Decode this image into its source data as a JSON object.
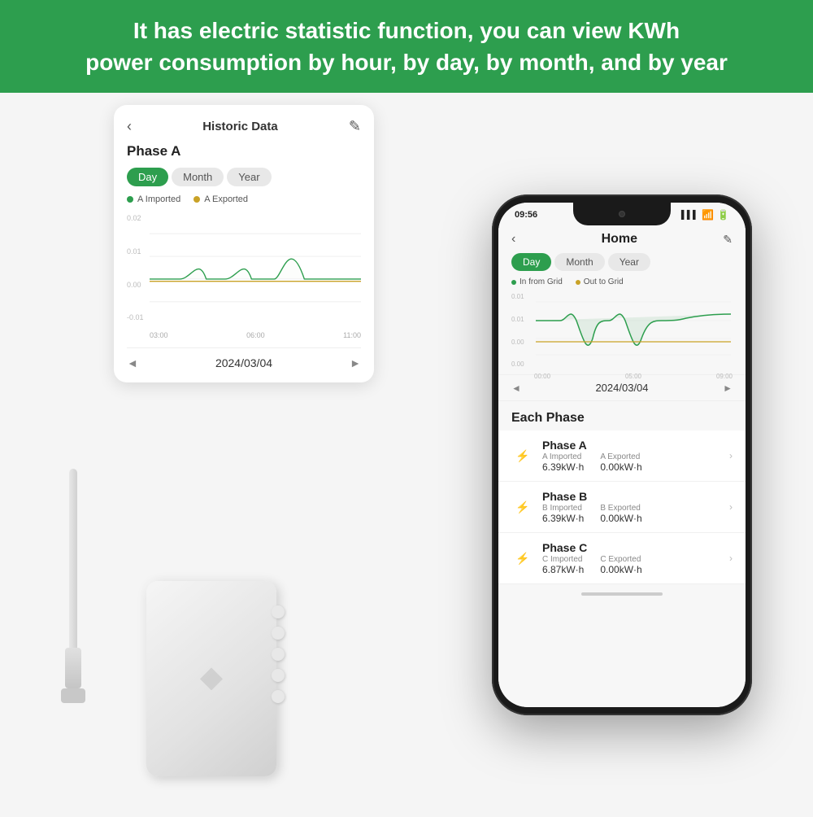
{
  "header": {
    "line1": "It has electric statistic function, you can view KWh",
    "line2": "power consumption by hour, by day, by month, and by year",
    "bg_color": "#2d9e4e",
    "text_color": "#ffffff"
  },
  "historic_card": {
    "title": "Historic Data",
    "back_icon": "‹",
    "edit_icon": "✎",
    "phase_label": "Phase A",
    "tabs": [
      "Day",
      "Month",
      "Year"
    ],
    "active_tab": "Day",
    "legend": [
      {
        "label": "A Imported",
        "color": "#2d9e4e"
      },
      {
        "label": "A Exported",
        "color": "#c9a227"
      }
    ],
    "y_labels": [
      "0.02",
      "0.01",
      "0.00",
      "-0.01"
    ],
    "x_labels": [
      "03:00",
      "06:00",
      "11:00"
    ],
    "date": "2024/03/04"
  },
  "phone": {
    "time": "09:56",
    "signal_bars": "▌▌▌",
    "wifi_icon": "wifi",
    "battery_icon": "battery",
    "app_title": "Home",
    "back_icon": "‹",
    "edit_icon": "✎",
    "tabs": [
      "Day",
      "Month",
      "Year"
    ],
    "active_tab": "Day",
    "legend": [
      {
        "label": "In from Grid",
        "color": "#2d9e4e"
      },
      {
        "label": "Out to Grid",
        "color": "#c9a227"
      }
    ],
    "y_labels": [
      "0.01",
      "0.01",
      "0.00",
      "0.00"
    ],
    "x_labels": [
      "00:00",
      "05:00",
      "09:00"
    ],
    "date": "2024/03/04",
    "each_phase_title": "Each Phase",
    "phases": [
      {
        "name": "Phase A",
        "icon": "⚡",
        "icon_color": "green",
        "imported_label": "A Imported",
        "imported_value": "6.39kW·h",
        "exported_label": "A Exported",
        "exported_value": "0.00kW·h"
      },
      {
        "name": "Phase B",
        "icon": "⚡",
        "icon_color": "orange",
        "imported_label": "B Imported",
        "imported_value": "6.39kW·h",
        "exported_label": "B Exported",
        "exported_value": "0.00kW·h"
      },
      {
        "name": "Phase C",
        "icon": "⚡",
        "icon_color": "blue",
        "imported_label": "C Imported",
        "imported_value": "6.87kW·h",
        "exported_label": "C Exported",
        "exported_value": "0.00kW·h"
      }
    ]
  }
}
